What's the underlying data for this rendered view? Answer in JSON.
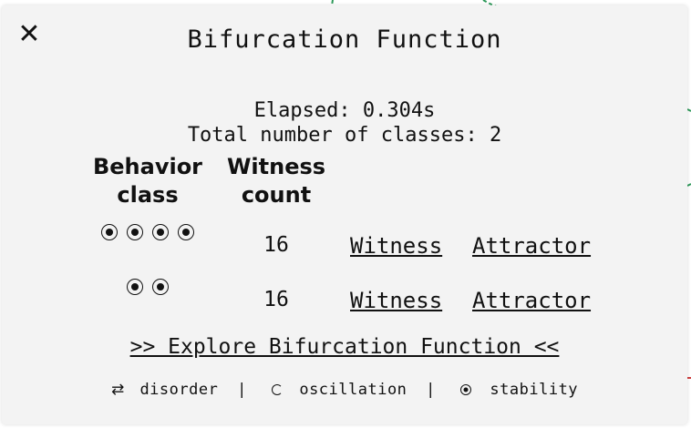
{
  "dialog": {
    "title": "Bifurcation Function",
    "close_glyph": "✕",
    "elapsed": "Elapsed: 0.304s",
    "total_classes": "Total number of classes: 2"
  },
  "table": {
    "headers": {
      "behavior_class_line1": "Behavior",
      "behavior_class_line2": "class",
      "witness_count_line1": "Witness",
      "witness_count_line2": "count"
    },
    "rows": [
      {
        "stability_icons": 4,
        "count": "16",
        "witness_link": "Witness",
        "attractor_link": "Attractor"
      },
      {
        "stability_icons": 2,
        "count": "16",
        "witness_link": "Witness",
        "attractor_link": "Attractor"
      }
    ]
  },
  "explore_link": ">> Explore Bifurcation Function <<",
  "legend": {
    "disorder_glyph": "⇄",
    "disorder": "disorder",
    "separator": "|",
    "oscillation": "oscillation",
    "stability": "stability"
  },
  "colors": {
    "dialog_bg": "#f3f3f3",
    "text": "#111111",
    "edge_accent_green": "#2e9a5a",
    "edge_accent_red": "#d04040"
  }
}
